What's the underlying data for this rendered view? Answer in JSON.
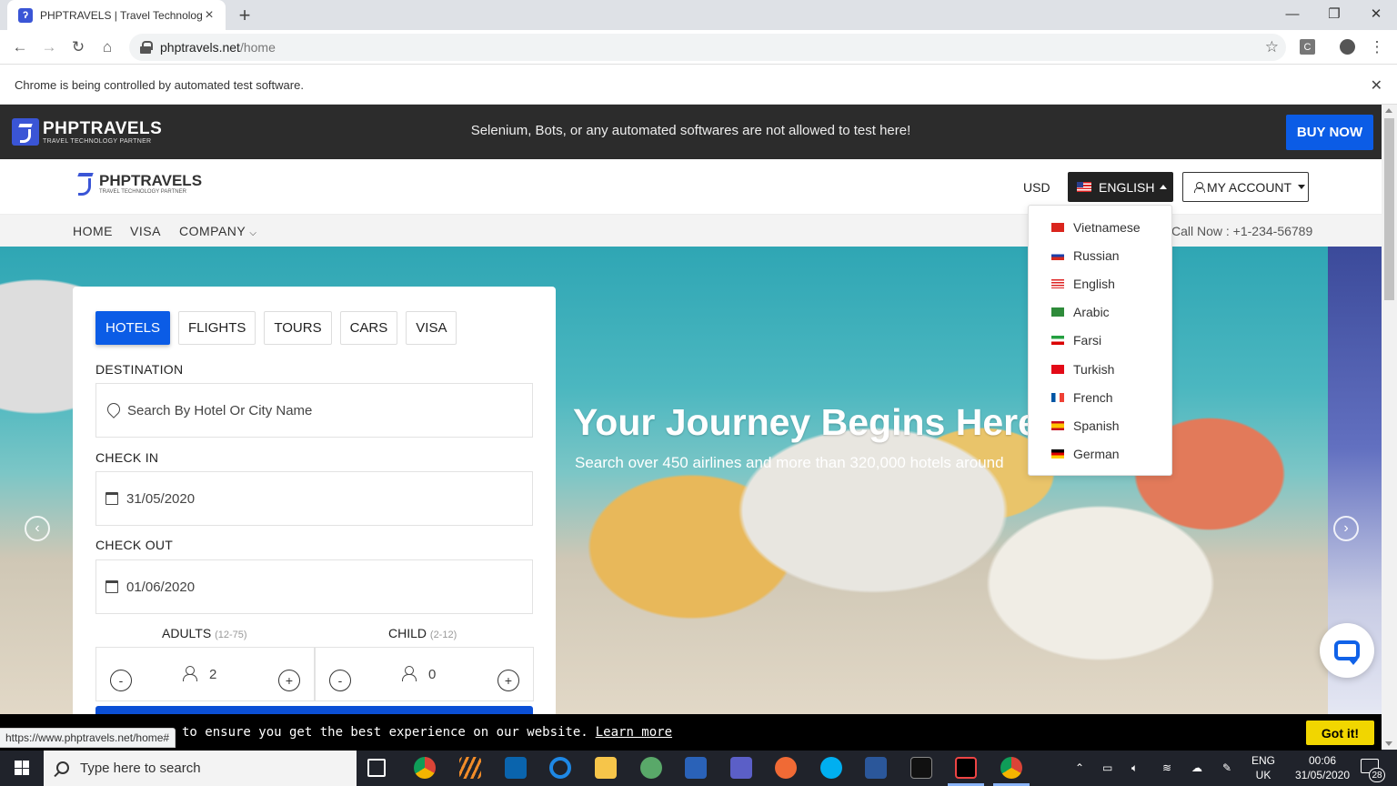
{
  "browser": {
    "tab_title": "PHPTRAVELS | Travel Technology",
    "url_host": "phptravels.net",
    "url_path": "/home",
    "infobar_text": "Chrome is being controlled by automated test software.",
    "status_url": "https://www.phptravels.net/home#",
    "extension_letter": "C"
  },
  "banner": {
    "brand_name": "PHPTRAVELS",
    "brand_tagline": "TRAVEL TECHNOLOGY PARTNER",
    "notice": "Selenium, Bots, or any automated softwares are not allowed to test here!",
    "buy_label": "BUY NOW"
  },
  "header": {
    "logo_name": "PHPTRAVELS",
    "logo_tagline": "TRAVEL TECHNOLOGY PARTNER",
    "currency": "USD",
    "language": "ENGLISH",
    "account": "MY ACCOUNT"
  },
  "menu": {
    "home": "HOME",
    "visa": "VISA",
    "company": "COMPANY",
    "callnow": "Call Now : +1-234-56789"
  },
  "language_menu": [
    {
      "label": "Vietnamese",
      "flag": "vn"
    },
    {
      "label": "Russian",
      "flag": "ru"
    },
    {
      "label": "English",
      "flag": "us"
    },
    {
      "label": "Arabic",
      "flag": "sa"
    },
    {
      "label": "Farsi",
      "flag": "ir"
    },
    {
      "label": "Turkish",
      "flag": "tr"
    },
    {
      "label": "French",
      "flag": "fr"
    },
    {
      "label": "Spanish",
      "flag": "es"
    },
    {
      "label": "German",
      "flag": "de"
    }
  ],
  "hero": {
    "title": "Your Journey Begins Here",
    "subtitle": "Search over 450 airlines and more than 320,000 hotels around"
  },
  "search": {
    "tabs": [
      "HOTELS",
      "FLIGHTS",
      "TOURS",
      "CARS",
      "VISA"
    ],
    "active_tab": "HOTELS",
    "destination_label": "DESTINATION",
    "destination_placeholder": "Search By Hotel Or City Name",
    "checkin_label": "CHECK IN",
    "checkin_value": "31/05/2020",
    "checkout_label": "CHECK OUT",
    "checkout_value": "01/06/2020",
    "adults_label": "ADULTS",
    "adults_range": "(12-75)",
    "adults_value": "2",
    "child_label": "CHILD",
    "child_range": "(2-12)",
    "child_value": "0",
    "minus": "-",
    "plus": "+"
  },
  "cookie": {
    "text": "to ensure you get the best experience on our website.",
    "learn_more": "Learn more",
    "button": "Got it!"
  },
  "taskbar": {
    "search_placeholder": "Type here to search",
    "lang_line1": "ENG",
    "lang_line2": "UK",
    "time": "00:06",
    "date": "31/05/2020",
    "notification_count": "28"
  },
  "colors": {
    "brand_blue": "#0b5ce6",
    "dark_banner": "#2c2c2c",
    "cookie_button": "#f1d600"
  }
}
